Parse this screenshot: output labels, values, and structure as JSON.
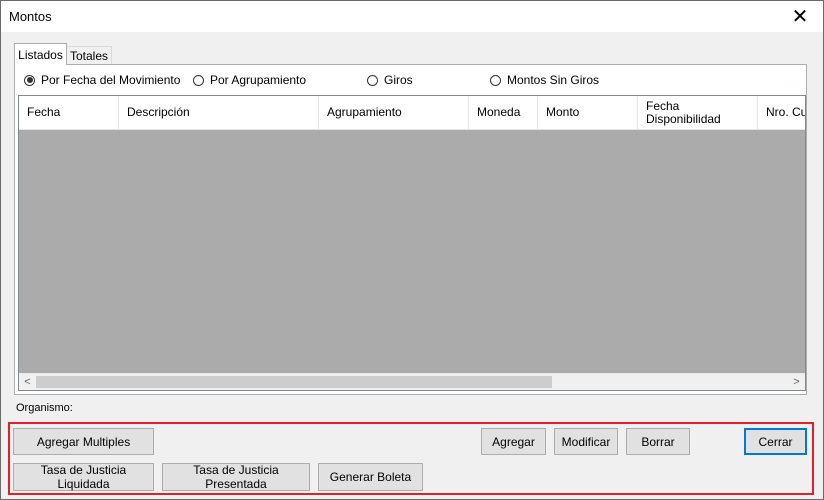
{
  "window": {
    "title": "Montos",
    "close_symbol": "✕"
  },
  "tabs": [
    {
      "label": "Listados",
      "active": true
    },
    {
      "label": "Totales",
      "active": false
    }
  ],
  "radios": [
    {
      "label": "Por Fecha del Movimiento",
      "checked": true
    },
    {
      "label": "Por Agrupamiento",
      "checked": false
    },
    {
      "label": "Giros",
      "checked": false
    },
    {
      "label": "Montos Sin Giros",
      "checked": false
    }
  ],
  "grid": {
    "columns": [
      "Fecha",
      "Descripción",
      "Agrupamiento",
      "Moneda",
      "Monto",
      "Fecha\nDisponibilidad",
      "Nro. Cue"
    ],
    "rows": []
  },
  "scrollbar": {
    "left_arrow": "<",
    "right_arrow": ">"
  },
  "organismo_label": "Organismo:",
  "buttons": {
    "agregar_multiples": "Agregar Multiples",
    "agregar": "Agregar",
    "modificar": "Modificar",
    "borrar": "Borrar",
    "cerrar": "Cerrar",
    "tasa_liquidada": "Tasa de Justicia Liquidada",
    "tasa_presentada": "Tasa de Justicia Presentada",
    "generar_boleta": "Generar Boleta"
  },
  "colors": {
    "highlight_border": "#e0202a",
    "default_button_border": "#0078d7",
    "grid_background": "#ababab"
  }
}
